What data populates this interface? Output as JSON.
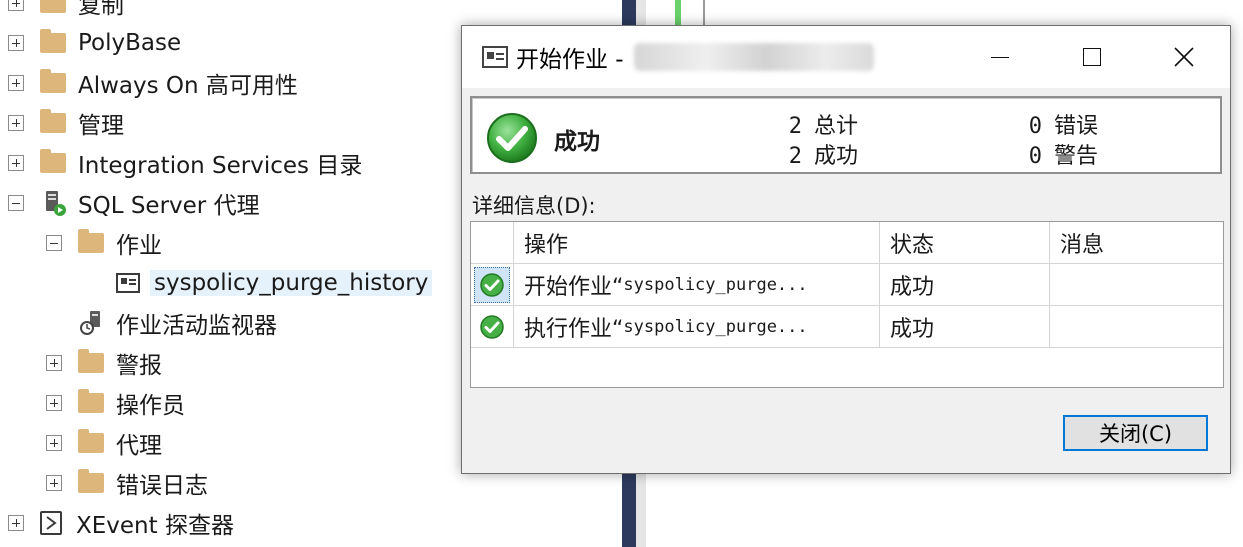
{
  "tree": {
    "items": [
      {
        "label": "复制",
        "level": 0,
        "expander": "plus",
        "icon": "folder-icon"
      },
      {
        "label": "PolyBase",
        "level": 0,
        "expander": "plus",
        "icon": "folder-icon"
      },
      {
        "label": "Always On 高可用性",
        "level": 0,
        "expander": "plus",
        "icon": "folder-icon"
      },
      {
        "label": "管理",
        "level": 0,
        "expander": "plus",
        "icon": "folder-icon"
      },
      {
        "label": "Integration Services 目录",
        "level": 0,
        "expander": "plus",
        "icon": "folder-icon"
      },
      {
        "label": "SQL Server 代理",
        "level": 0,
        "expander": "minus",
        "icon": "sql-agent-icon"
      },
      {
        "label": "作业",
        "level": 1,
        "expander": "minus",
        "icon": "folder-icon"
      },
      {
        "label": "syspolicy_purge_history",
        "level": 2,
        "expander": "none",
        "icon": "job-icon",
        "selected": true
      },
      {
        "label": "作业活动监视器",
        "level": 1,
        "expander": "none",
        "icon": "job-activity-monitor-icon"
      },
      {
        "label": "警报",
        "level": 1,
        "expander": "plus",
        "icon": "folder-icon"
      },
      {
        "label": "操作员",
        "level": 1,
        "expander": "plus",
        "icon": "folder-icon"
      },
      {
        "label": "代理",
        "level": 1,
        "expander": "plus",
        "icon": "folder-icon"
      },
      {
        "label": "错误日志",
        "level": 1,
        "expander": "plus",
        "icon": "folder-icon"
      },
      {
        "label": "XEvent 探查器",
        "level": 0,
        "expander": "plus",
        "icon": "xevent-icon"
      }
    ]
  },
  "dialog": {
    "title": "开始作业 -",
    "window_controls": {
      "minimize": "—",
      "maximize": "☐",
      "close": "✕"
    },
    "summary": {
      "status_label": "成功",
      "total_count": "2",
      "total_label": "总计",
      "success_count": "2",
      "success_label": "成功",
      "error_count": "0",
      "error_label": "错误",
      "warning_count": "0",
      "warning_label": "警告"
    },
    "details_label": "详细信息(D):",
    "grid": {
      "columns": [
        "操作",
        "状态",
        "消息"
      ],
      "rows": [
        {
          "prefix": "开始作业“",
          "name": "syspolicy_purge...",
          "status": "成功",
          "message": "",
          "icon": "success-check-icon"
        },
        {
          "prefix": "执行作业“",
          "name": "syspolicy_purge...",
          "status": "成功",
          "message": "",
          "icon": "success-check-icon"
        }
      ]
    },
    "close_button": "关闭(C)"
  },
  "colors": {
    "splitter": "#2d3a5e",
    "folder": "#dcb67a",
    "success_green": "#4caf50",
    "focus_blue": "#0078d7"
  }
}
